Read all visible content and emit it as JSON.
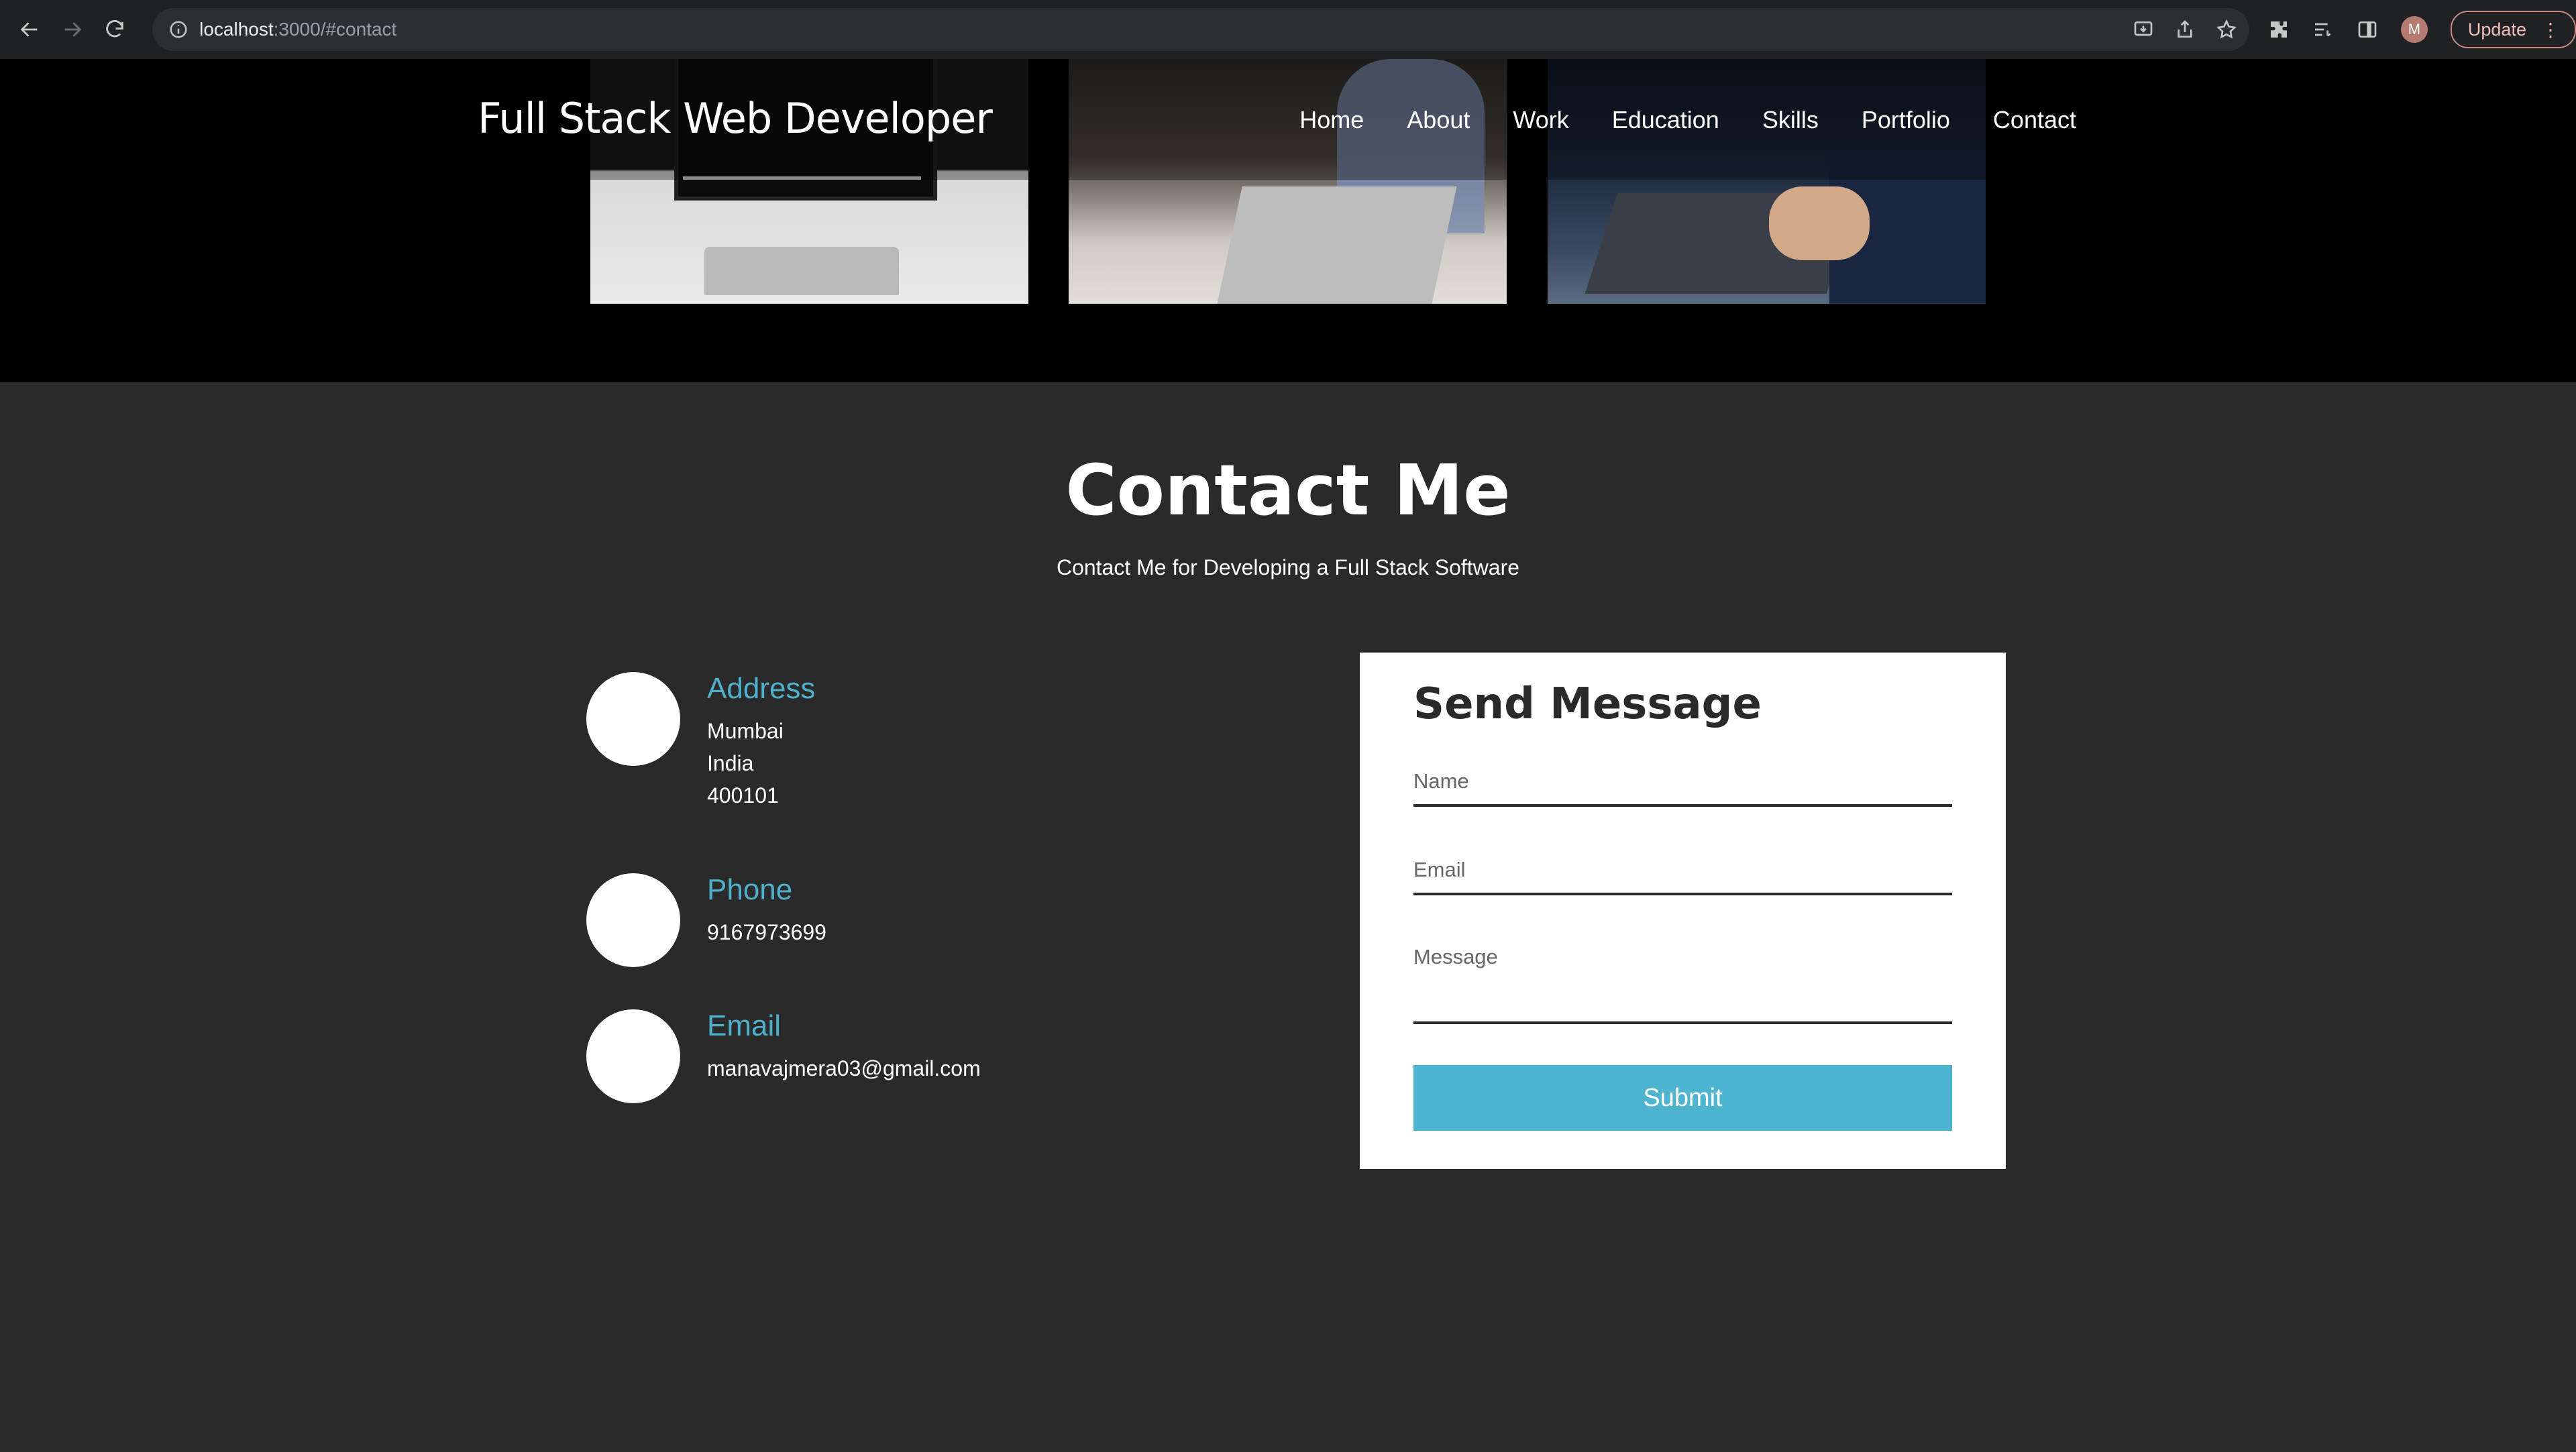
{
  "browser": {
    "url_host": "localhost",
    "url_path": ":3000/#contact",
    "update_label": "Update",
    "profile_initial": "M"
  },
  "header": {
    "brand": "Full Stack Web Developer",
    "nav": [
      "Home",
      "About",
      "Work",
      "Education",
      "Skills",
      "Portfolio",
      "Contact"
    ]
  },
  "contact": {
    "title": "Contact Me",
    "subtitle": "Contact Me for Developing a Full Stack Software",
    "address": {
      "label": "Address",
      "lines": [
        "Mumbai",
        "India",
        "400101"
      ]
    },
    "phone": {
      "label": "Phone",
      "value": "9167973699"
    },
    "email": {
      "label": "Email",
      "value": "manavajmera03@gmail.com"
    }
  },
  "form": {
    "title": "Send Message",
    "name_placeholder": "Name",
    "email_placeholder": "Email",
    "message_placeholder": "Message",
    "submit_label": "Submit"
  },
  "colors": {
    "accent": "#4fb0cb",
    "section_bg": "#2a2a2a",
    "hero_bg": "#000000"
  }
}
